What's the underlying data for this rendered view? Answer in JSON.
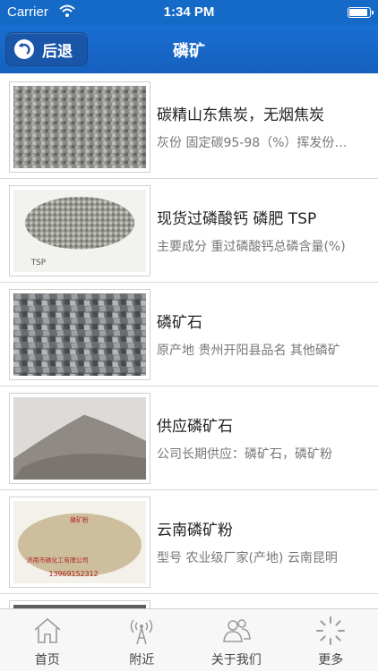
{
  "status_bar": {
    "carrier": "Carrier",
    "time": "1:34 PM"
  },
  "nav": {
    "back_label": "后退",
    "title": "磷矿"
  },
  "items": [
    {
      "title": "碳精山东焦炭，无烟焦炭",
      "subtitle": "灰份 固定碳95-98（%）挥发份（%）"
    },
    {
      "title": "现货过磷酸钙 磷肥 TSP",
      "subtitle": "主要成分 重过磷酸钙总磷含量(%)"
    },
    {
      "title": "磷矿石",
      "subtitle": "原产地 贵州开阳县品名 其他磷矿"
    },
    {
      "title": "供应磷矿石",
      "subtitle": "公司长期供应：磷矿石，磷矿粉"
    },
    {
      "title": "云南磷矿粉",
      "subtitle": "型号 农业级厂家(产地) 云南昆明"
    }
  ],
  "thumb_text": {
    "tsp": "TSP",
    "bag_label": "磷矿粉",
    "company": "济南市磷化工有限公司",
    "phone": "13969152312"
  },
  "tabs": [
    {
      "label": "首页",
      "icon": "home-icon"
    },
    {
      "label": "附近",
      "icon": "antenna-icon"
    },
    {
      "label": "关于我们",
      "icon": "people-icon"
    },
    {
      "label": "更多",
      "icon": "spinner-icon"
    }
  ]
}
